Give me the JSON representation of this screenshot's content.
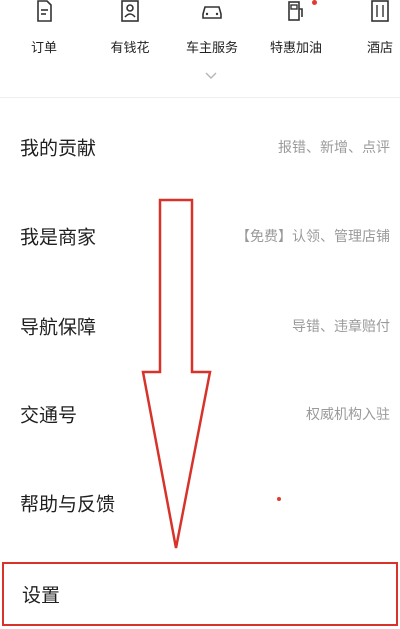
{
  "quick_actions": [
    {
      "label": "订单",
      "icon": "order-doc-icon"
    },
    {
      "label": "有钱花",
      "icon": "id-card-icon"
    },
    {
      "label": "车主服务",
      "icon": "car-icon"
    },
    {
      "label": "特惠加油",
      "icon": "fuel-pump-icon"
    },
    {
      "label": "酒店",
      "icon": "hotel-icon"
    }
  ],
  "menu": [
    {
      "title": "我的贡献",
      "subtitle": "报错、新增、点评"
    },
    {
      "title": "我是商家",
      "subtitle": "【免费】认领、管理店铺"
    },
    {
      "title": "导航保障",
      "subtitle": "导错、违章赔付"
    },
    {
      "title": "交通号",
      "subtitle": "权威机构入驻"
    },
    {
      "title": "帮助与反馈",
      "subtitle": ""
    }
  ],
  "settings": {
    "title": "设置"
  },
  "colors": {
    "accent_red": "#d7332a",
    "text_primary": "#1f1f1f",
    "text_secondary": "#9a9a9a"
  }
}
